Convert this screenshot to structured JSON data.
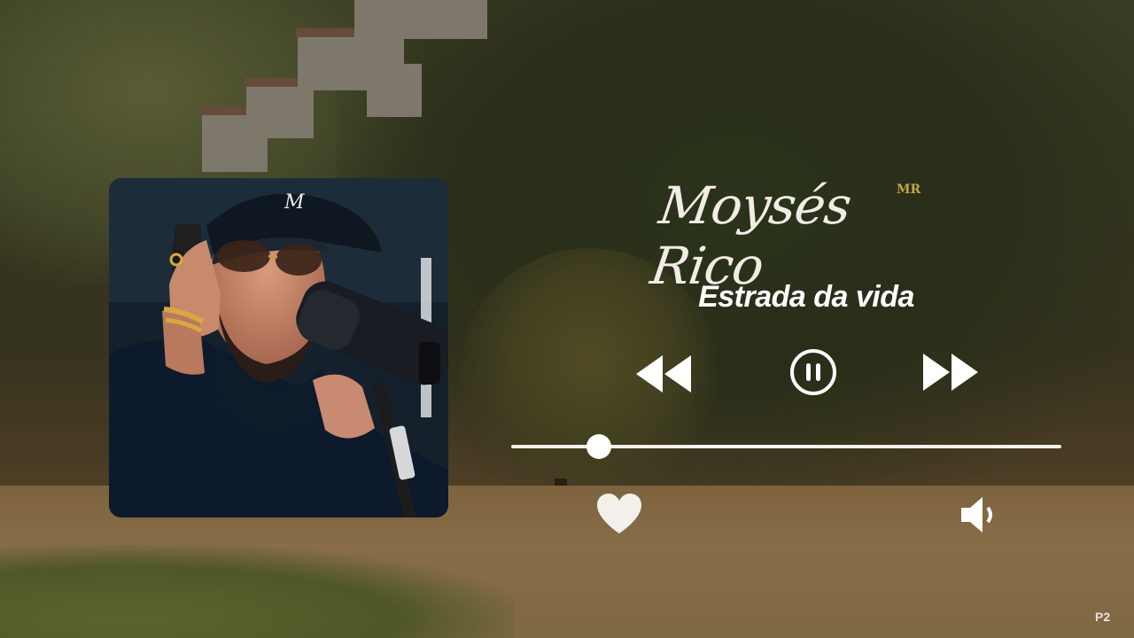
{
  "artist": {
    "name": "Moysés Rico",
    "badge": "MR"
  },
  "track": {
    "title": "Estrada da vida"
  },
  "player": {
    "progress": 0.16,
    "state": "playing"
  },
  "icons": {
    "rewind": "rewind-icon",
    "pause": "pause-icon",
    "forward": "fast-forward-icon",
    "like": "heart-icon",
    "volume": "speaker-icon"
  },
  "colors": {
    "controls": "#ffffff",
    "badge": "#c6a34a"
  },
  "watermark": {
    "corner": "P2"
  }
}
